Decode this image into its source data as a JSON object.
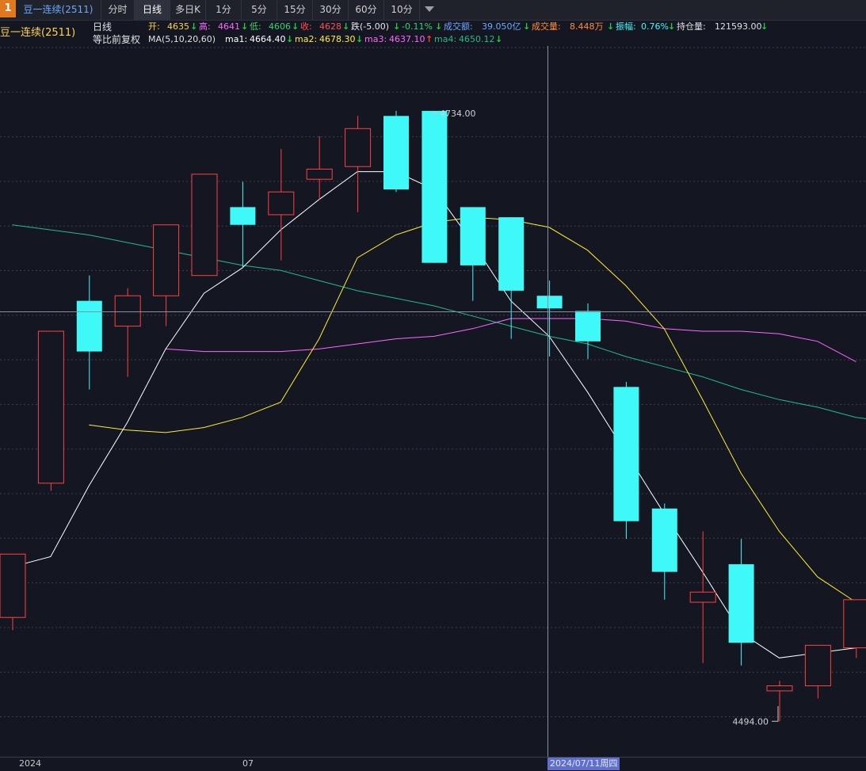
{
  "toolbar": {
    "badge": "1",
    "symbol_tab": "豆一连续(2511)",
    "tabs": [
      "分时",
      "日线",
      "多日K",
      "1分",
      "5分",
      "15分",
      "30分",
      "60分",
      "10分"
    ],
    "active_tab": "日线"
  },
  "info": {
    "name": "豆一连续(2511)",
    "period": "日线",
    "adjust": "等比前复权",
    "ma_label": "MA(5,10,20,60)",
    "open_label": "开:",
    "open": "4635",
    "high_label": "高:",
    "high": "4641",
    "low_label": "低:",
    "low": "4606",
    "close_label": "收:",
    "close": "4628",
    "change_label": "跌(-5.00)",
    "change_pct": "-0.11%",
    "amount_label": "成交额:",
    "amount": "39.050亿",
    "volume_label": "成交量:",
    "volume": "8.448万",
    "amplitude_label": "振幅:",
    "amplitude": "0.76%",
    "oi_label": "持仓量:",
    "oi": "121593.00",
    "ma1_label": "ma1:",
    "ma1": "4664.40",
    "ma2_label": "ma2:",
    "ma2": "4678.30",
    "ma3_label": "ma3:",
    "ma3": "4637.10",
    "ma4_label": "ma4:",
    "ma4": "4650.12",
    "arrow_down": "↓",
    "arrow_up": "↑"
  },
  "colors": {
    "up": "#ff4040",
    "down": "#3ff8f8",
    "ma1": "#ffffff",
    "ma2": "#ffee33",
    "ma3": "#ff66ff",
    "ma4": "#22bb88",
    "info_label": "#d0d0d0"
  },
  "chart_data": {
    "type": "candlestick",
    "ylim": [
      4480,
      4760
    ],
    "max_label": "4734.00",
    "min_label": "4494.00",
    "candles": [
      {
        "o": 4535,
        "h": 4540,
        "l": 4530,
        "c": 4560
      },
      {
        "o": 4588,
        "h": 4640,
        "l": 4585,
        "c": 4648
      },
      {
        "o": 4660,
        "h": 4670,
        "l": 4625,
        "c": 4640
      },
      {
        "o": 4650,
        "h": 4665,
        "l": 4630,
        "c": 4662
      },
      {
        "o": 4662,
        "h": 4680,
        "l": 4650,
        "c": 4690
      },
      {
        "o": 4670,
        "h": 4705,
        "l": 4685,
        "c": 4710
      },
      {
        "o": 4697,
        "h": 4707,
        "l": 4673,
        "c": 4690
      },
      {
        "o": 4694,
        "h": 4720,
        "l": 4676,
        "c": 4703
      },
      {
        "o": 4708,
        "h": 4725,
        "l": 4700,
        "c": 4712
      },
      {
        "o": 4713,
        "h": 4733,
        "l": 4695,
        "c": 4728
      },
      {
        "o": 4733,
        "h": 4735,
        "l": 4703,
        "c": 4704
      },
      {
        "o": 4735,
        "h": 4734,
        "l": 4675,
        "c": 4675
      },
      {
        "o": 4697,
        "h": 4696,
        "l": 4660,
        "c": 4674
      },
      {
        "o": 4693,
        "h": 4685,
        "l": 4645,
        "c": 4664
      },
      {
        "o": 4662,
        "h": 4668,
        "l": 4638,
        "c": 4657
      },
      {
        "o": 4656,
        "h": 4659,
        "l": 4637,
        "c": 4644
      },
      {
        "o": 4626,
        "h": 4628,
        "l": 4566,
        "c": 4573
      },
      {
        "o": 4578,
        "h": 4580,
        "l": 4542,
        "c": 4553
      },
      {
        "o": 4541,
        "h": 4569,
        "l": 4517,
        "c": 4545
      },
      {
        "o": 4556,
        "h": 4566,
        "l": 4516,
        "c": 4525
      },
      {
        "o": 4506,
        "h": 4510,
        "l": 4494,
        "c": 4508
      },
      {
        "o": 4508,
        "h": 4511,
        "l": 4503,
        "c": 4524
      },
      {
        "o": 4523,
        "h": 4532,
        "l": 4519,
        "c": 4542
      }
    ],
    "ma1": [
      4555,
      4559,
      4587,
      4612,
      4641,
      4663,
      4673,
      4688,
      4700,
      4711,
      4711,
      4704,
      4683,
      4660,
      4646,
      4624,
      4600,
      4576,
      4553,
      4529,
      4519,
      4521,
      4523
    ],
    "ma2": [
      4611,
      4609,
      4608,
      4610,
      4614,
      4620,
      4645,
      4677,
      4686,
      4691,
      4693,
      4692,
      4689,
      4680,
      4666,
      4649,
      4621,
      4592,
      4569,
      4551,
      4541
    ],
    "ma3": [
      4641,
      4640,
      4640,
      4640,
      4641,
      4643,
      4645,
      4646,
      4649,
      4653,
      4653,
      4653,
      4652,
      4649,
      4648,
      4648,
      4647,
      4644,
      4636
    ],
    "ma4": [
      4690,
      4688,
      4686,
      4683,
      4680,
      4677,
      4674,
      4672,
      4668,
      4664,
      4661,
      4658,
      4654,
      4650,
      4646,
      4643,
      4638,
      4634,
      4630,
      4625,
      4621,
      4618,
      4614,
      4612
    ],
    "x_labels": [
      "2024",
      "07"
    ],
    "cursor_label": "2024/07/11周四"
  }
}
